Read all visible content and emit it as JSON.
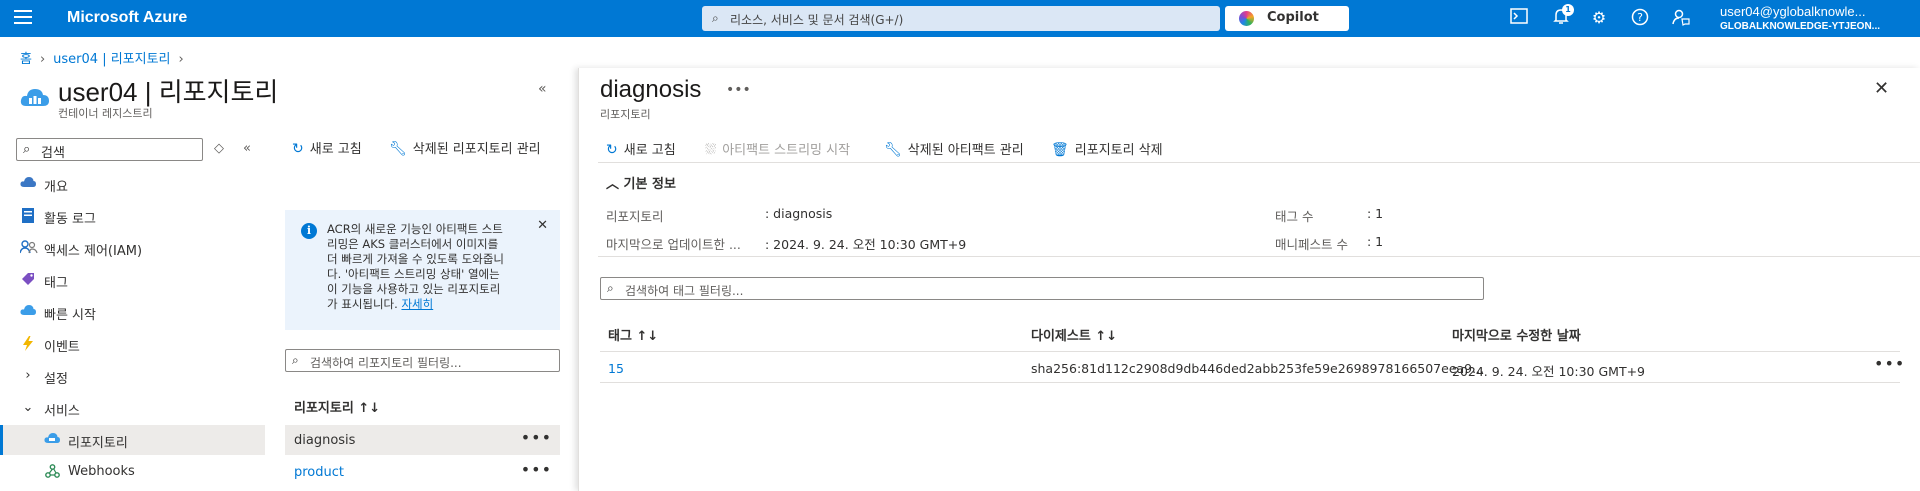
{
  "topbar": {
    "brand": "Microsoft Azure",
    "search_placeholder": "리소스, 서비스 및 문서 검색(G+/)",
    "copilot_label": "Copilot",
    "notification_count": "1",
    "user_name": "user04@yglobalknowle...",
    "user_tenant": "GLOBALKNOWLEDGE-YTJEON..."
  },
  "breadcrumb": {
    "home": "홈",
    "resource": "user04 | 리포지토리"
  },
  "resource": {
    "title": "user04 | 리포지토리",
    "subtitle": "컨테이너 레지스트리"
  },
  "sidebar": {
    "search_placeholder": "검색",
    "items": [
      {
        "label": "개요",
        "icon": "cloud-overview-icon"
      },
      {
        "label": "활동 로그",
        "icon": "activity-log-icon"
      },
      {
        "label": "액세스 제어(IAM)",
        "icon": "people-icon"
      },
      {
        "label": "태그",
        "icon": "tag-icon"
      },
      {
        "label": "빠른 시작",
        "icon": "quickstart-icon"
      },
      {
        "label": "이벤트",
        "icon": "lightning-icon"
      },
      {
        "label": "설정",
        "icon": "chevron-right-icon"
      },
      {
        "label": "서비스",
        "icon": "chevron-down-icon"
      },
      {
        "label": "리포지토리",
        "icon": "repository-icon"
      },
      {
        "label": "Webhooks",
        "icon": "webhook-icon"
      }
    ]
  },
  "repo_panel": {
    "refresh_label": "새로 고침",
    "manage_deleted_label": "삭제된 리포지토리 관리",
    "info_text_lines": [
      "ACR의 새로운 기능인 아티팩트 스트",
      "리밍은 AKS 클러스터에서 이미지를",
      "더 빠르게 가져올 수 있도록 도와줍니",
      "다. '아티팩트 스트리밍 상태' 열에는",
      "이 기능을 사용하고 있는 리포지토리",
      "가 표시됩니다."
    ],
    "info_link": "자세히",
    "filter_placeholder": "검색하여 리포지토리 필터링...",
    "column_header": "리포지토리 ↑↓",
    "repositories": [
      "diagnosis",
      "product"
    ]
  },
  "blade": {
    "title": "diagnosis",
    "subtitle": "리포지토리",
    "toolbar": {
      "refresh": "새로 고침",
      "start_streaming": "아티팩트 스트리밍 시작",
      "manage_deleted_artifacts": "삭제된 아티팩트 관리",
      "delete_repository": "리포지토리 삭제"
    },
    "essentials_header": "기본 정보",
    "essentials": {
      "repository_key": "리포지토리",
      "repository_value": ": diagnosis",
      "last_updated_key": "마지막으로 업데이트한 ...",
      "last_updated_value": ": 2024. 9. 24. 오전 10:30 GMT+9",
      "tag_count_key": "태그 수",
      "tag_count_value": ": 1",
      "manifest_count_key": "매니페스트 수",
      "manifest_count_value": ": 1"
    },
    "tag_filter_placeholder": "검색하여 태그 필터링...",
    "table": {
      "headers": [
        "태그 ↑↓",
        "다이제스트 ↑↓",
        "마지막으로 수정한 날짜"
      ],
      "rows": [
        [
          "15",
          "sha256:81d112c2908d9db446ded2abb253fe59e2698978166507eea9...",
          "2024. 9. 24. 오전 10:30 GMT+9"
        ]
      ]
    }
  },
  "colors": {
    "accent": "#0078d4",
    "selected_bg": "#edebe9",
    "info_bg": "#ebf3fc"
  }
}
